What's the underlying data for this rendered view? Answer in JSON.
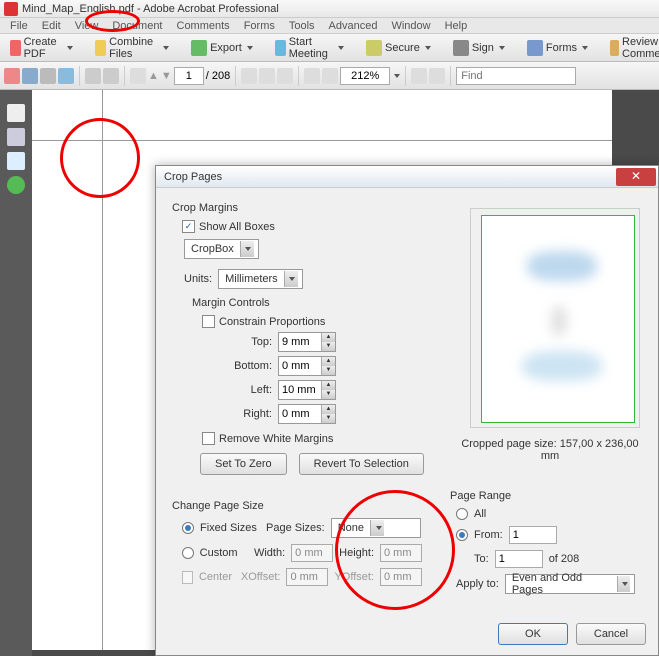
{
  "titlebar": {
    "text": "Mind_Map_English.pdf - Adobe Acrobat Professional"
  },
  "menubar": [
    "File",
    "Edit",
    "View",
    "Document",
    "Comments",
    "Forms",
    "Tools",
    "Advanced",
    "Window",
    "Help"
  ],
  "toolbar1": {
    "create": "Create PDF",
    "combine": "Combine Files",
    "export": "Export",
    "start": "Start Meeting",
    "secure": "Secure",
    "sign": "Sign",
    "forms": "Forms",
    "review": "Review & Comment"
  },
  "toolbar2": {
    "page_current": "1",
    "page_total": "/ 208",
    "zoom": "212%",
    "find_placeholder": "Find"
  },
  "dialog": {
    "title": "Crop Pages",
    "crop_margins_label": "Crop Margins",
    "show_all_boxes": "Show All Boxes",
    "cropbox": "CropBox",
    "units_label": "Units:",
    "units_value": "Millimeters",
    "margin_controls_label": "Margin Controls",
    "constrain": "Constrain Proportions",
    "top_label": "Top:",
    "top_val": "9 mm",
    "bottom_label": "Bottom:",
    "bottom_val": "0 mm",
    "left_label": "Left:",
    "left_val": "10 mm",
    "right_label": "Right:",
    "right_val": "0 mm",
    "remove_white": "Remove White Margins",
    "set_zero": "Set To Zero",
    "revert": "Revert To Selection",
    "cropped_size": "Cropped page size: 157,00 x 236,00 mm",
    "change_page_size": "Change Page Size",
    "fixed_sizes": "Fixed Sizes",
    "page_sizes_label": "Page Sizes:",
    "page_sizes_value": "None",
    "custom": "Custom",
    "width_label": "Width:",
    "width_val": "0 mm",
    "height_label": "Height:",
    "height_val": "0 mm",
    "center": "Center",
    "xoffset_label": "XOffset:",
    "xoffset_val": "0 mm",
    "yoffset_label": "YOffset:",
    "yoffset_val": "0 mm",
    "page_range": "Page Range",
    "all": "All",
    "from_label": "From:",
    "from_val": "1",
    "to_label": "To:",
    "to_val": "1",
    "to_total": "of 208",
    "apply_to_label": "Apply to:",
    "apply_to_value": "Even and Odd Pages",
    "ok": "OK",
    "cancel": "Cancel"
  }
}
